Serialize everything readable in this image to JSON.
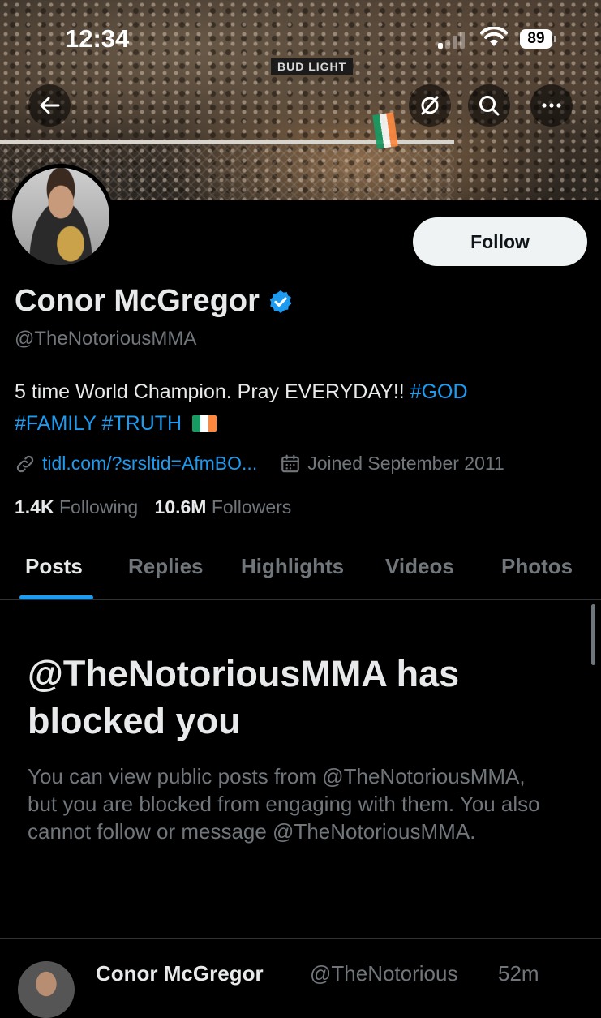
{
  "status_bar": {
    "time": "12:34",
    "battery": "89"
  },
  "banner": {
    "sign_text": "BUD LIGHT"
  },
  "profile": {
    "name": "Conor McGregor",
    "handle": "@TheNotoriousMMA",
    "follow_label": "Follow",
    "bio": {
      "text": "5 time World Champion. Pray EVERYDAY!!",
      "tag_god": "#GOD",
      "tag_family": "#FAMILY",
      "tag_truth": "#TRUTH"
    },
    "link": "tidl.com/?srsltid=AfmBO...",
    "joined": "Joined September 2011",
    "following_count": "1.4K",
    "following_label": "Following",
    "followers_count": "10.6M",
    "followers_label": "Followers"
  },
  "tabs": [
    {
      "label": "Posts",
      "active": true
    },
    {
      "label": "Replies"
    },
    {
      "label": "Highlights"
    },
    {
      "label": "Videos"
    },
    {
      "label": "Photos"
    }
  ],
  "blocked": {
    "title": "@TheNotoriousMMA has blocked you",
    "body": "You can view public posts from @TheNotoriousMMA, but you are blocked from engaging with them. You also cannot follow or message @TheNotoriousMMA."
  },
  "post_preview": {
    "name": "Conor McGregor",
    "handle": "@TheNotorious",
    "time": "52m"
  },
  "colors": {
    "accent": "#1d9bf0",
    "muted": "#71767b",
    "text": "#e7e9ea",
    "background": "#000000"
  },
  "icons": [
    "back-arrow-icon",
    "hide-icon",
    "search-icon",
    "more-icon",
    "verified-badge-icon",
    "link-icon",
    "calendar-icon",
    "irish-flag-emoji"
  ]
}
